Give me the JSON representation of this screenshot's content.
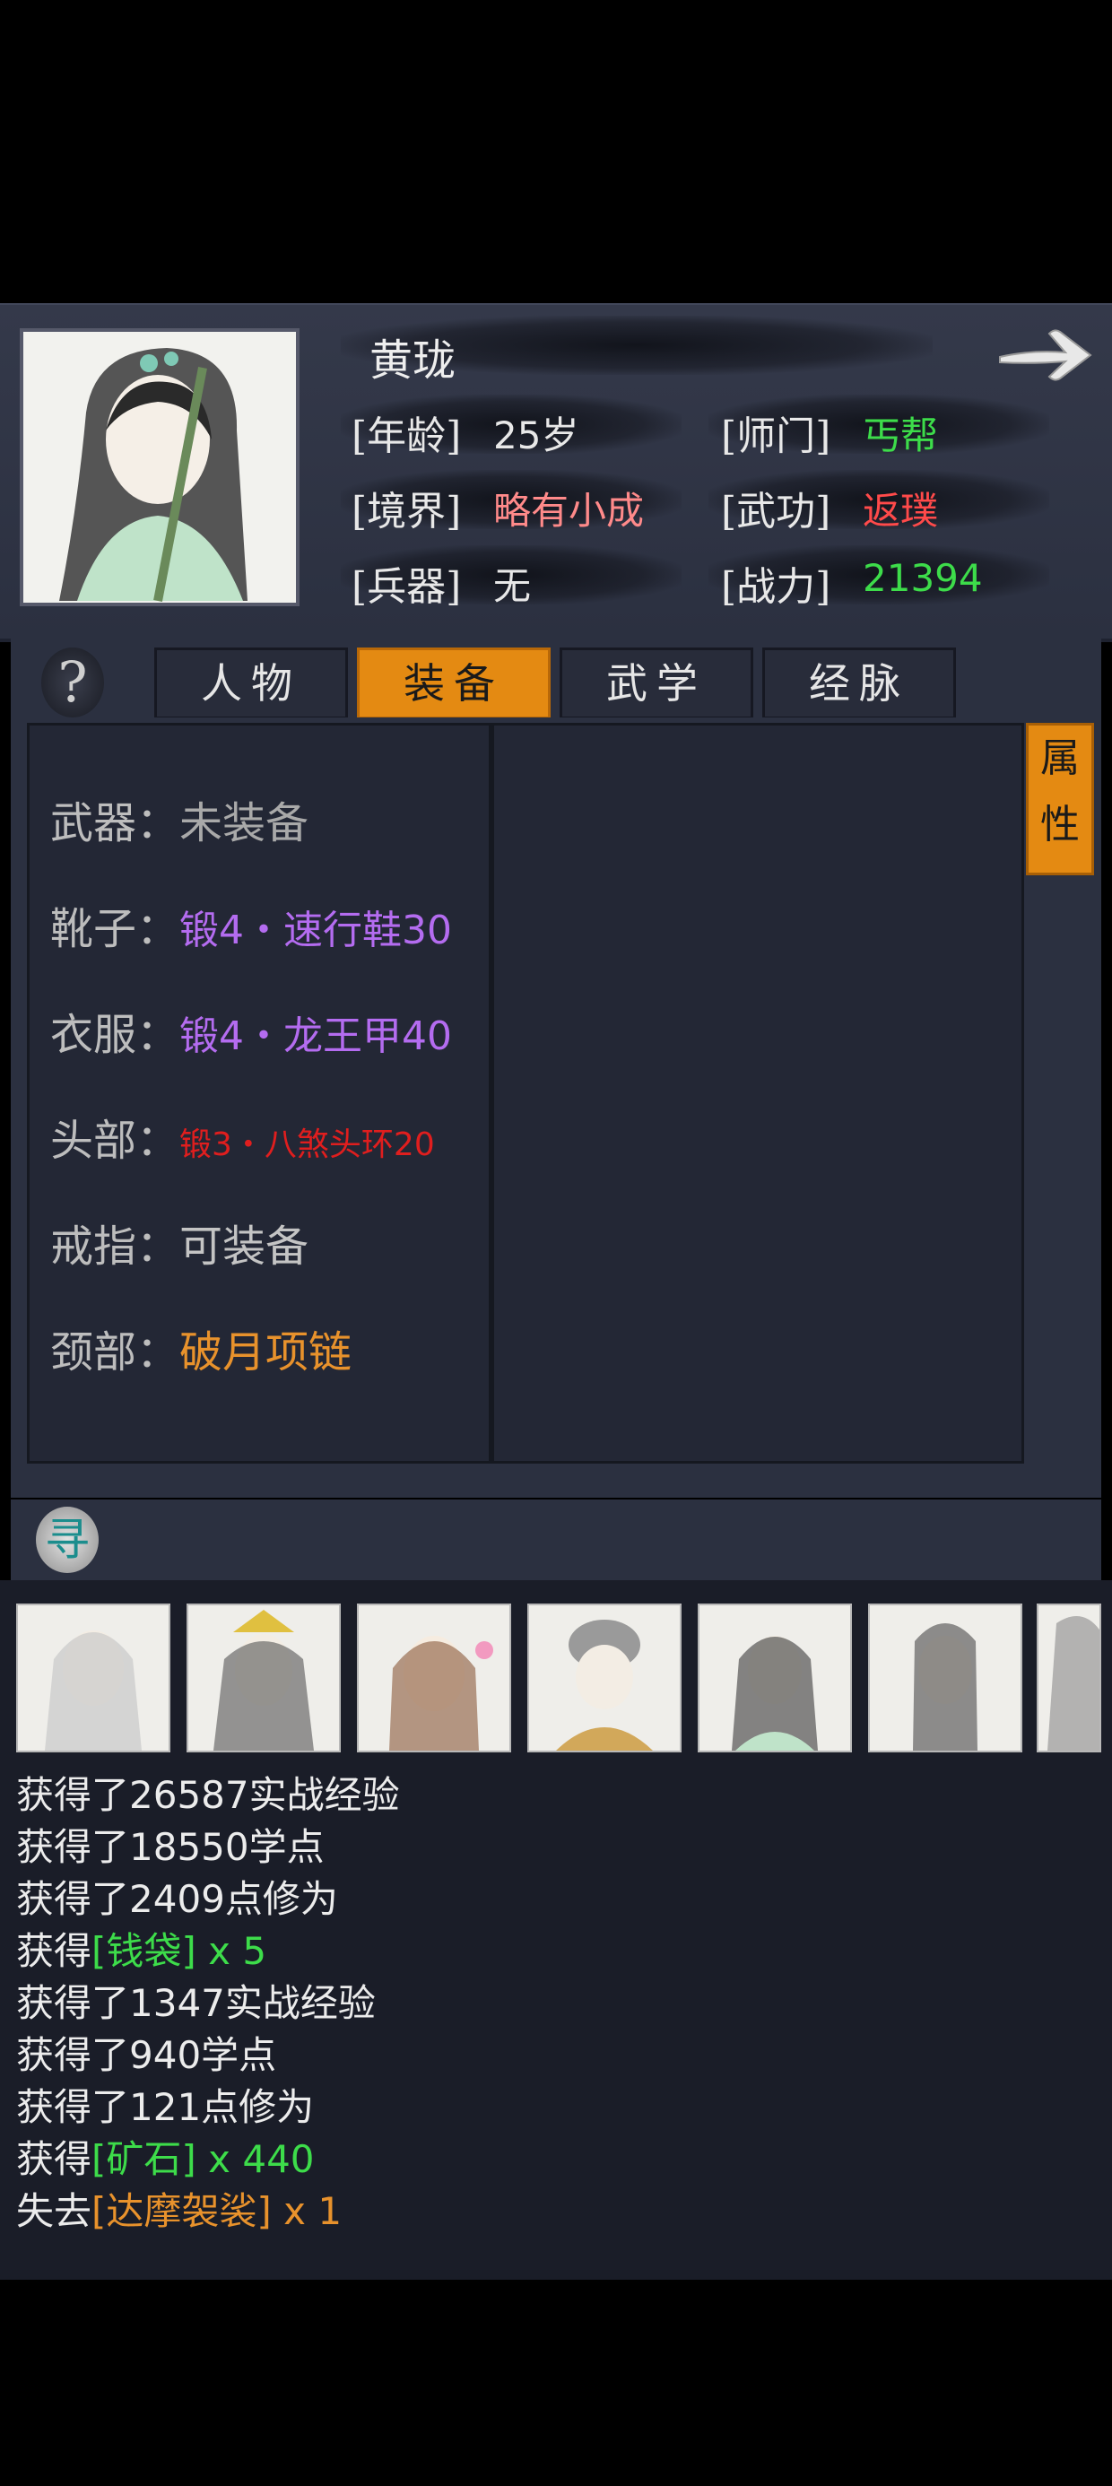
{
  "character": {
    "name": "黄珑",
    "age_label": "[年龄]",
    "age_value": "25岁",
    "school_label": "[师门]",
    "school_value": "丐帮",
    "realm_label": "[境界]",
    "realm_value": "略有小成",
    "martial_label": "[武功]",
    "martial_value": "返璞",
    "weapon_label": "[兵器]",
    "weapon_value": "无",
    "power_label": "[战力]",
    "power_value": "21394"
  },
  "tabs": [
    {
      "label": "人物",
      "active": false
    },
    {
      "label": "装备",
      "active": true
    },
    {
      "label": "武学",
      "active": false
    },
    {
      "label": "经脉",
      "active": false
    }
  ],
  "help_glyph": "?",
  "attr_button": {
    "line1": "属",
    "line2": "性"
  },
  "equipment": [
    {
      "slot": "武器：",
      "item": "未装备",
      "color": "#a9a9a9"
    },
    {
      "slot": "靴子：",
      "item": "锻4・速行鞋30",
      "color": "#b46cf0"
    },
    {
      "slot": "衣服：",
      "item": "锻4・龙王甲40",
      "color": "#b46cf0"
    },
    {
      "slot": "头部：",
      "item": "锻3・八煞头环20",
      "color": "#e01e1e"
    },
    {
      "slot": "戒指：",
      "item": "可装备",
      "color": "#c4c4c4"
    },
    {
      "slot": "颈部：",
      "item": "破月项链",
      "color": "#e8922c"
    }
  ],
  "search_glyph": "寻",
  "log": [
    {
      "text": "获得了26587实战经验"
    },
    {
      "text": "获得了18550学点"
    },
    {
      "text": "获得了2409点修为"
    },
    {
      "prefix": "获得",
      "item": "[钱袋] x 5",
      "item_color": "green"
    },
    {
      "text": "获得了1347实战经验"
    },
    {
      "text": "获得了940学点"
    },
    {
      "text": "获得了121点修为"
    },
    {
      "prefix": "获得",
      "item": "[矿石] x 440",
      "item_color": "green"
    },
    {
      "prefix": "失去",
      "item": "[达摩袈裟] x 1",
      "item_color": "orange"
    }
  ],
  "colors": {
    "school": "#3ddc4a",
    "realm": "#ff8a8a",
    "martial": "#ff4a4a",
    "power": "#3ddc4a",
    "tab_active": "#e48a12"
  }
}
